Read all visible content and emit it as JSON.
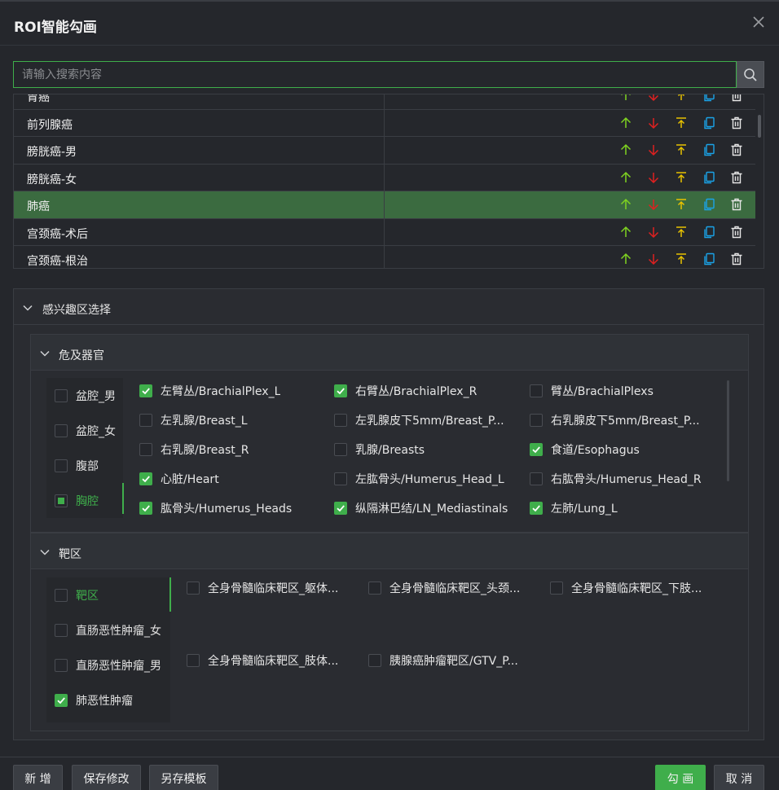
{
  "title": "ROI智能勾画",
  "search": {
    "placeholder": "请输入搜索内容"
  },
  "templates": [
    {
      "name": "胃癌",
      "active": false
    },
    {
      "name": "前列腺癌",
      "active": false
    },
    {
      "name": "膀胱癌-男",
      "active": false
    },
    {
      "name": "膀胱癌-女",
      "active": false
    },
    {
      "name": "肺癌",
      "active": true
    },
    {
      "name": "宫颈癌-术后",
      "active": false
    },
    {
      "name": "宫颈癌-根治",
      "active": false
    }
  ],
  "roi_section": {
    "title": "感兴趣区选择"
  },
  "oar_section": {
    "title": "危及器官",
    "categories": [
      {
        "label": "盆腔_男",
        "state": "off"
      },
      {
        "label": "盆腔_女",
        "state": "off"
      },
      {
        "label": "腹部",
        "state": "off"
      },
      {
        "label": "胸腔",
        "state": "partial"
      }
    ],
    "items": [
      {
        "label": "左臂丛/BrachialPlex_L",
        "checked": true
      },
      {
        "label": "右臂丛/BrachialPlex_R",
        "checked": true
      },
      {
        "label": "臂丛/BrachialPlexs",
        "checked": false
      },
      {
        "label": "左乳腺/Breast_L",
        "checked": false
      },
      {
        "label": "左乳腺皮下5mm/Breast_P...",
        "checked": false
      },
      {
        "label": "右乳腺皮下5mm/Breast_P...",
        "checked": false
      },
      {
        "label": "右乳腺/Breast_R",
        "checked": false
      },
      {
        "label": "乳腺/Breasts",
        "checked": false
      },
      {
        "label": "食道/Esophagus",
        "checked": true
      },
      {
        "label": "心脏/Heart",
        "checked": true
      },
      {
        "label": "左肱骨头/Humerus_Head_L",
        "checked": false
      },
      {
        "label": "右肱骨头/Humerus_Head_R",
        "checked": false
      },
      {
        "label": "肱骨头/Humerus_Heads",
        "checked": true
      },
      {
        "label": "纵隔淋巴结/LN_Mediastinals",
        "checked": true
      },
      {
        "label": "左肺/Lung_L",
        "checked": true
      }
    ]
  },
  "target_section": {
    "title": "靶区",
    "categories": [
      {
        "label": "靶区",
        "state": "off"
      },
      {
        "label": "直肠恶性肿瘤_女",
        "state": "off"
      },
      {
        "label": "直肠恶性肿瘤_男",
        "state": "off"
      },
      {
        "label": "肺恶性肿瘤",
        "state": "on"
      }
    ],
    "items": [
      {
        "label": "全身骨髓临床靶区_躯体...",
        "checked": false
      },
      {
        "label": "全身骨髓临床靶区_头颈...",
        "checked": false
      },
      {
        "label": "全身骨髓临床靶区_下肢...",
        "checked": false
      },
      {
        "label": "全身骨髓临床靶区_肢体...",
        "checked": false
      },
      {
        "label": "胰腺癌肿瘤靶区/GTV_P...",
        "checked": false
      }
    ]
  },
  "buttons": {
    "add": "新 增",
    "save": "保存修改",
    "save_as": "另存模板",
    "draw": "勾 画",
    "cancel": "取 消"
  },
  "colors": {
    "accent": "#3fae4b",
    "up": "#7fd320",
    "down": "#e02020",
    "top": "#e8c200",
    "copy": "#1aa3e8",
    "delete": "#e6e6e6"
  }
}
